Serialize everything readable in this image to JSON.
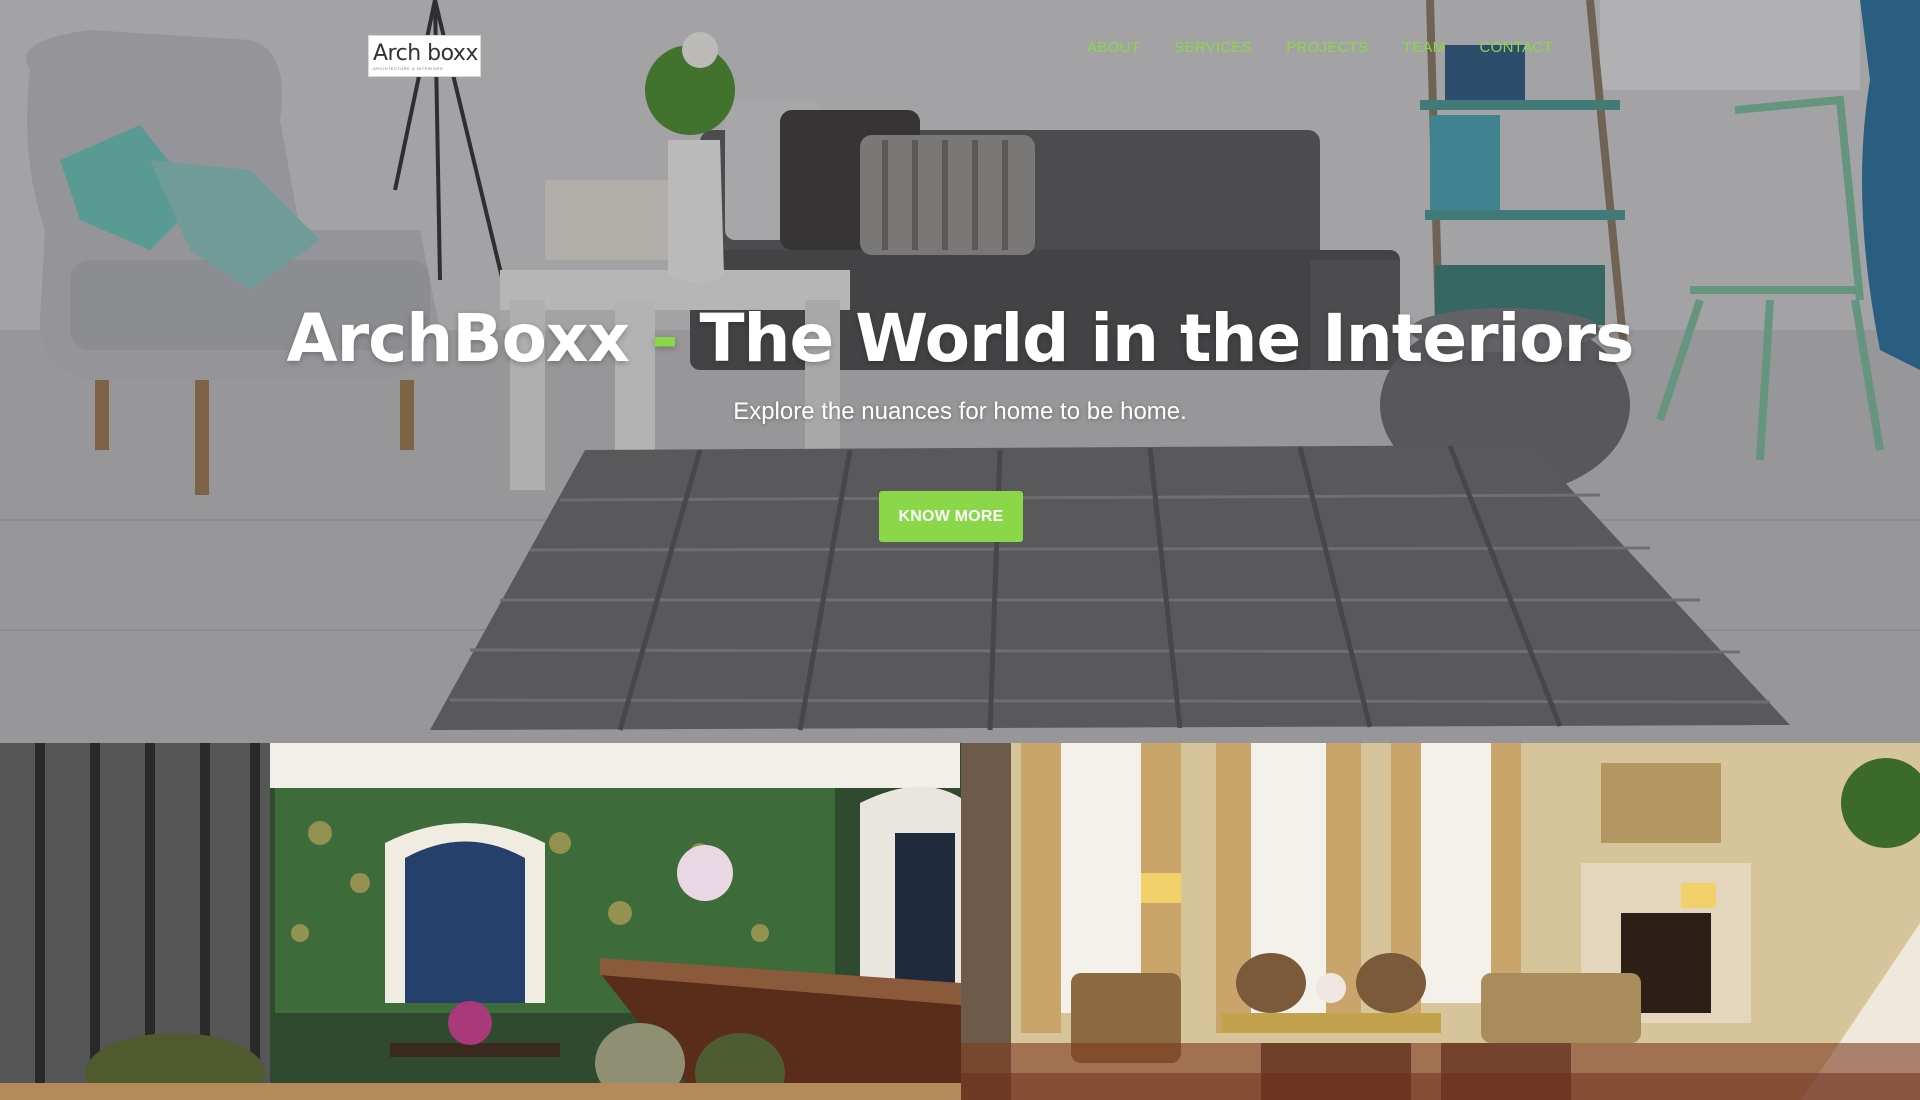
{
  "brand": {
    "logo_text": "Arch boxx",
    "logo_tagline": "ARCHITECTURE & INTERIORS"
  },
  "nav": {
    "items": [
      {
        "label": "ABOUT"
      },
      {
        "label": "SERVICES"
      },
      {
        "label": "PROJECTS"
      },
      {
        "label": "TEAM"
      },
      {
        "label": "CONTACT"
      }
    ]
  },
  "hero": {
    "title_brand": "ArchBoxx",
    "title_separator": "-",
    "title_rest": "The World in the Interiors",
    "subtitle": "Explore the nuances for home to be home.",
    "cta_label": "KNOW MORE"
  },
  "colors": {
    "accent": "#8bd74a",
    "hero_text": "#ffffff"
  },
  "gallery": {
    "images": [
      {
        "icon": "green-bar-lounge-image"
      },
      {
        "icon": "classic-living-room-image"
      }
    ]
  }
}
